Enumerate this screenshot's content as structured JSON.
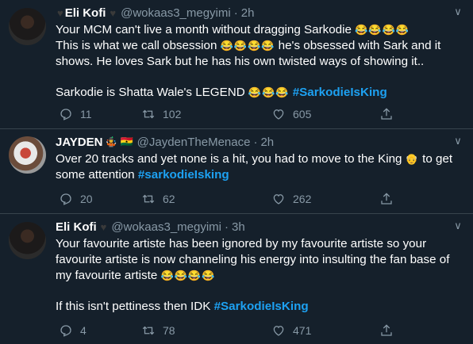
{
  "tweets": [
    {
      "name": "Eli Kofi",
      "handle": "@wokaas3_megyimi",
      "time": "2h",
      "lines": [
        "Your MCM can't live a month without dragging Sarkodie",
        "This is what we call obsession",
        "he's obsessed with Sark and it",
        "shows. He loves Sark but he has his own twisted ways of showing it..",
        "Sarkodie is Shatta Wale's LEGEND"
      ],
      "hashtag": "#SarkodieIsKing",
      "replies": "11",
      "retweets": "102",
      "likes": "605"
    },
    {
      "name": "JAYDEN",
      "handle": "@JaydenTheMenace",
      "time": "2h",
      "lines": [
        "Over 20 tracks and yet none is a hit, you had to move to the King",
        "to get",
        "some attention"
      ],
      "hashtag": "#sarkodieIsking",
      "replies": "20",
      "retweets": "62",
      "likes": "262"
    },
    {
      "name": "Eli Kofi",
      "handle": "@wokaas3_megyimi",
      "time": "3h",
      "lines": [
        "Your favourite artiste has been ignored by my favourite artiste so your",
        "favourite artiste is now channeling his energy into insulting the fan base of",
        "my favourite artiste",
        "If this isn't pettiness then IDK"
      ],
      "hashtag": "#SarkodieIsKing",
      "replies": "4",
      "retweets": "78",
      "likes": "471"
    }
  ],
  "emoji": {
    "laugh4": "😂😂😂😂",
    "laugh3": "😂😂😂",
    "king": "👴",
    "laugh4b": "😂😂😂😂",
    "flag": "🇬🇭"
  },
  "icons": [
    "reply-icon",
    "retweet-icon",
    "like-icon",
    "share-icon",
    "chevron-down-icon"
  ]
}
